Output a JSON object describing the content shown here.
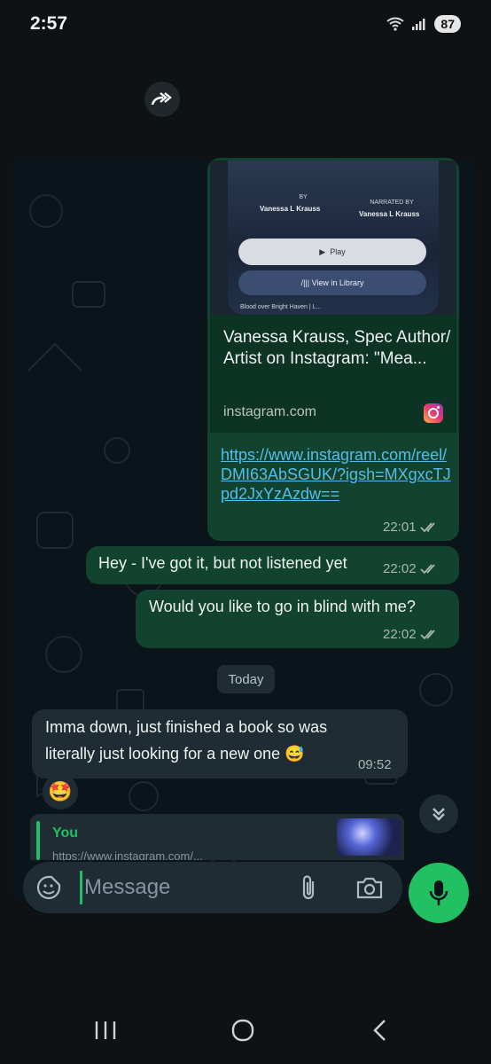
{
  "status_bar": {
    "time": "2:57",
    "battery": "87"
  },
  "chat": {
    "shared_preview": {
      "by_label": "BY",
      "by_name": "Vanessa L Krauss",
      "narrated_label": "NARRATED BY",
      "narrated_name": "Vanessa L Krauss",
      "play_label": "Play",
      "library_label": "/|||  View in Library",
      "footer_text": "Blood over Bright Haven | L..."
    },
    "link_card": {
      "title": "Vanessa Krauss, Spec Author/ Artist on Instagram: \"Mea...",
      "domain": "instagram.com"
    },
    "messages": [
      {
        "text": "https://www.instagram.com/reel/DMI63AbSGUK/?igsh=MXgxcTJpd2JxYzAzdw==",
        "time": "22:01",
        "direction": "outgoing"
      },
      {
        "text": "Hey - I've got it, but not listened yet",
        "time": "22:02",
        "direction": "outgoing"
      },
      {
        "text": "Would you like to go in blind with me?",
        "time": "22:02",
        "direction": "outgoing"
      },
      {
        "text": "Imma down, just finished a book so was",
        "text2": "literally just looking for a new one",
        "emoji": "😅",
        "time": "09:52",
        "direction": "incoming"
      }
    ],
    "day_divider": "Today",
    "reaction_emoji": "🤩",
    "reply_preview": {
      "author": "You",
      "snippet": "https://www.instagram.com/..."
    }
  },
  "composer": {
    "placeholder": "Message"
  },
  "colors": {
    "outgoing_bubble": "#12432f",
    "incoming_bubble": "#1f2c33",
    "accent": "#21c063",
    "link": "#53bdeb"
  }
}
